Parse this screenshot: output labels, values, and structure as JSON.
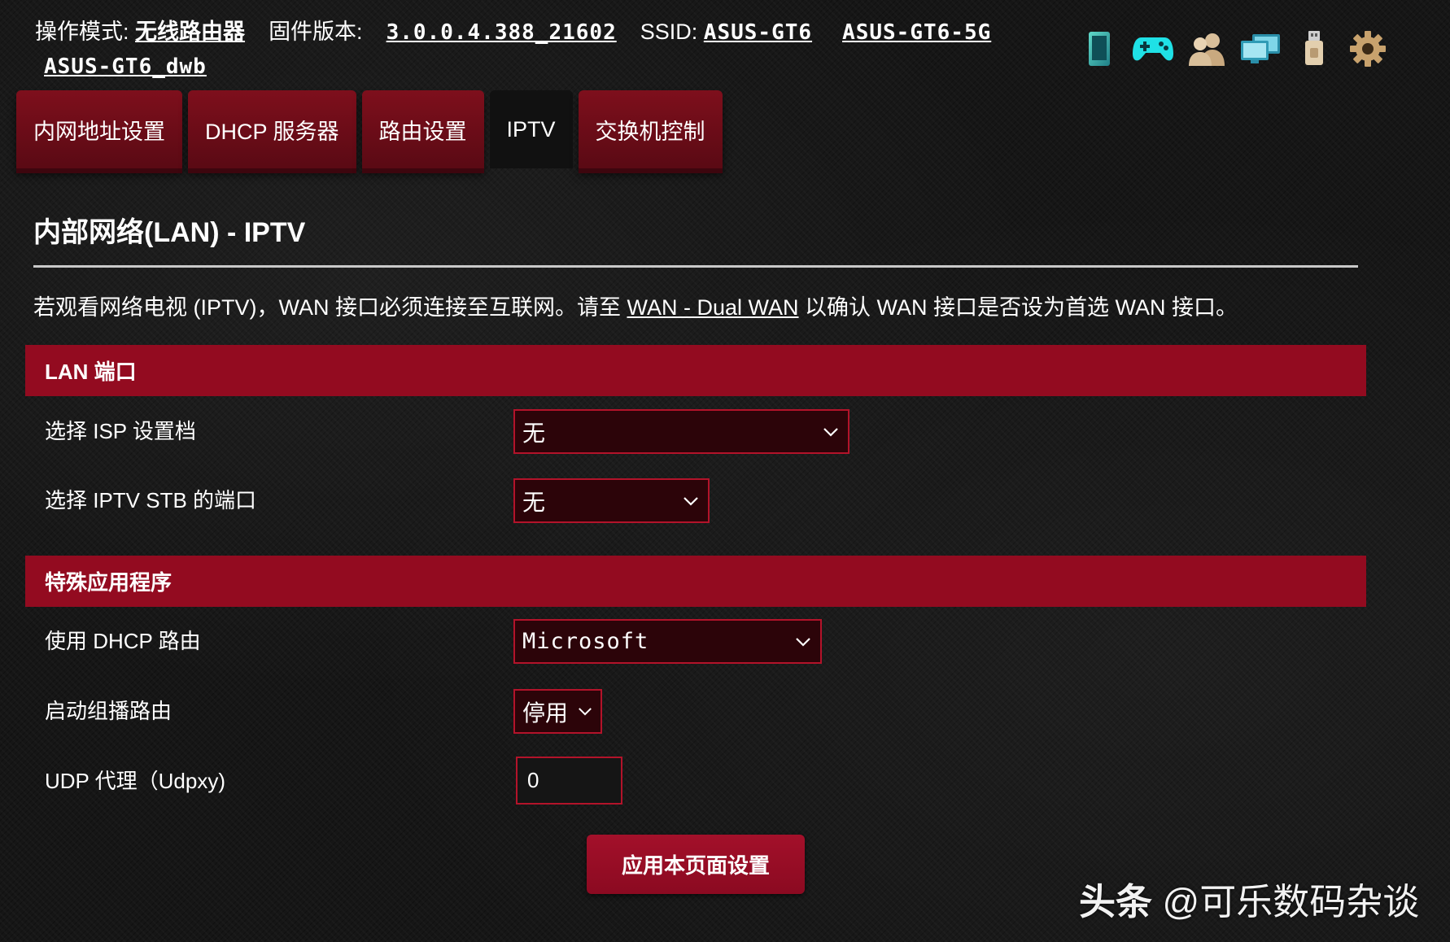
{
  "header": {
    "mode_label": "操作模式:",
    "mode_value": "无线路由器",
    "firmware_label": "固件版本:",
    "firmware_value": "3.0.0.4.388_21602",
    "ssid_label": "SSID:",
    "ssids": [
      "ASUS-GT6",
      "ASUS-GT6-5G",
      "ASUS-GT6_dwb"
    ]
  },
  "status_icons": [
    "phone-icon",
    "gamepad-icon",
    "users-icon",
    "network-monitor-icon",
    "usb-icon",
    "settings-gear-icon"
  ],
  "tabs": [
    {
      "label": "内网地址设置",
      "active": false
    },
    {
      "label": "DHCP 服务器",
      "active": false
    },
    {
      "label": "路由设置",
      "active": false
    },
    {
      "label": "IPTV",
      "active": true
    },
    {
      "label": "交换机控制",
      "active": false
    }
  ],
  "page": {
    "title": "内部网络(LAN) - IPTV",
    "description_before": "若观看网络电视 (IPTV)，WAN 接口必须连接至互联网。请至 ",
    "description_link": "WAN - Dual WAN",
    "description_after": " 以确认 WAN 接口是否设为首选 WAN 接口。"
  },
  "lan_section": {
    "header": "LAN 端口",
    "isp_profile": {
      "label": "选择 ISP 设置档",
      "value": "无"
    },
    "stb_port": {
      "label": "选择 IPTV STB 的端口",
      "value": "无"
    }
  },
  "special_section": {
    "header": "特殊应用程序",
    "dhcp_route": {
      "label": "使用 DHCP 路由",
      "value": "Microsoft"
    },
    "multicast_routing": {
      "label": "启动组播路由",
      "value": "停用"
    },
    "udpxy": {
      "label": "UDP 代理（Udpxy)",
      "value": "0"
    }
  },
  "apply_button_label": "应用本页面设置",
  "watermark": {
    "brand": "头条",
    "handle": "@可乐数码杂谈"
  },
  "colors": {
    "accent": "#930b20",
    "select_bg": "#2c0409",
    "border": "#b3132a",
    "page_bg": "#161616"
  }
}
